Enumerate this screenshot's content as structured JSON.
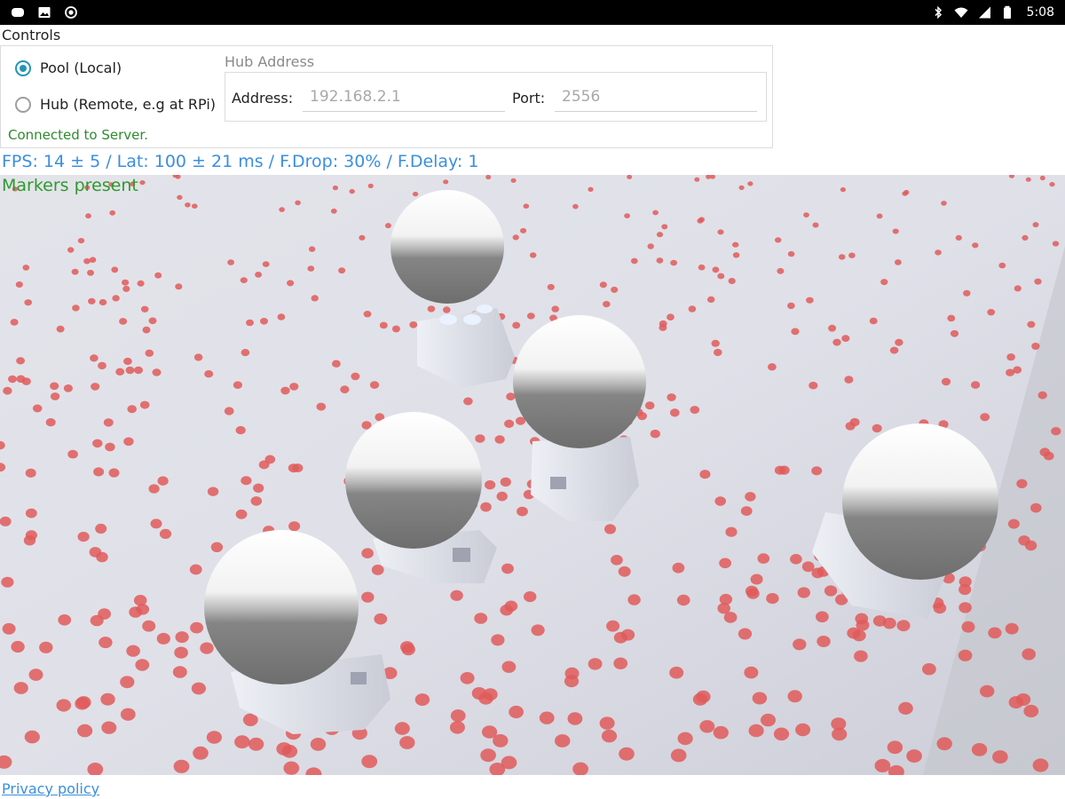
{
  "status_bar": {
    "time": "5:08",
    "left_icons": [
      "message-icon",
      "image-icon",
      "record-icon"
    ],
    "right_icons": [
      "bluetooth-icon",
      "wifi-icon",
      "signal-icon",
      "battery-icon"
    ]
  },
  "controls": {
    "title": "Controls",
    "mode_options": [
      {
        "label": "Pool (Local)",
        "selected": true
      },
      {
        "label": "Hub (Remote, e.g at RPi)",
        "selected": false
      }
    ],
    "connection_status": "Connected to Server.",
    "hub": {
      "title": "Hub Address",
      "address_label": "Address:",
      "address_placeholder": "192.168.2.1",
      "port_label": "Port:",
      "port_placeholder": "2556"
    }
  },
  "stats": {
    "text": "FPS: 14 ± 5 / Lat: 100 ± 21 ms / F.Drop: 30% / F.Delay: 1"
  },
  "camera": {
    "overlay_text": "Markers present",
    "marker_color": "#e05a5a"
  },
  "footer": {
    "privacy_link": "Privacy policy"
  },
  "colors": {
    "accent": "#2196b6",
    "stats_text": "#3a8fe0",
    "success_text": "#2e8b2e"
  }
}
